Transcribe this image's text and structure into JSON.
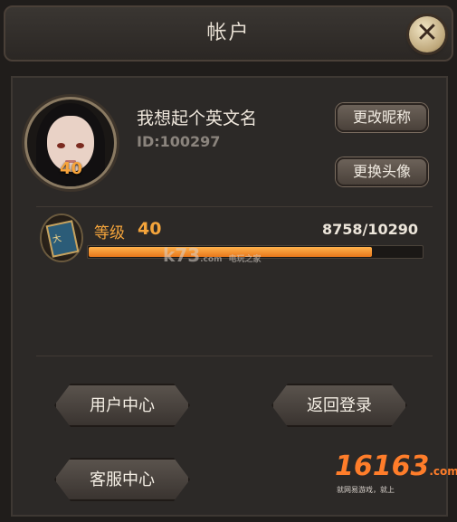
{
  "title": "帐户",
  "profile": {
    "name": "我想起个英文名",
    "uid": "ID:100297",
    "avatar_level": "40",
    "rename_button": "更改昵称",
    "change_avatar_button": "更换头像"
  },
  "level": {
    "label": "等级",
    "value": "40",
    "exp_text": "8758/10290",
    "progress_fraction": 0.851
  },
  "buttons": {
    "user_center": "用户中心",
    "back_login": "返回登录",
    "customer_service": "客服中心"
  },
  "watermark": {
    "k73": "k73",
    "k73_sub": ".com",
    "k73_cn": "电玩之家",
    "site2": "16163",
    "site2_sub": ".com",
    "site2_slogan": "就网易游戏，就上"
  },
  "colors": {
    "accent": "#f4a43b",
    "progress": "#f2951f"
  },
  "icons": {
    "close": "close-icon",
    "book": "level-book-icon"
  }
}
